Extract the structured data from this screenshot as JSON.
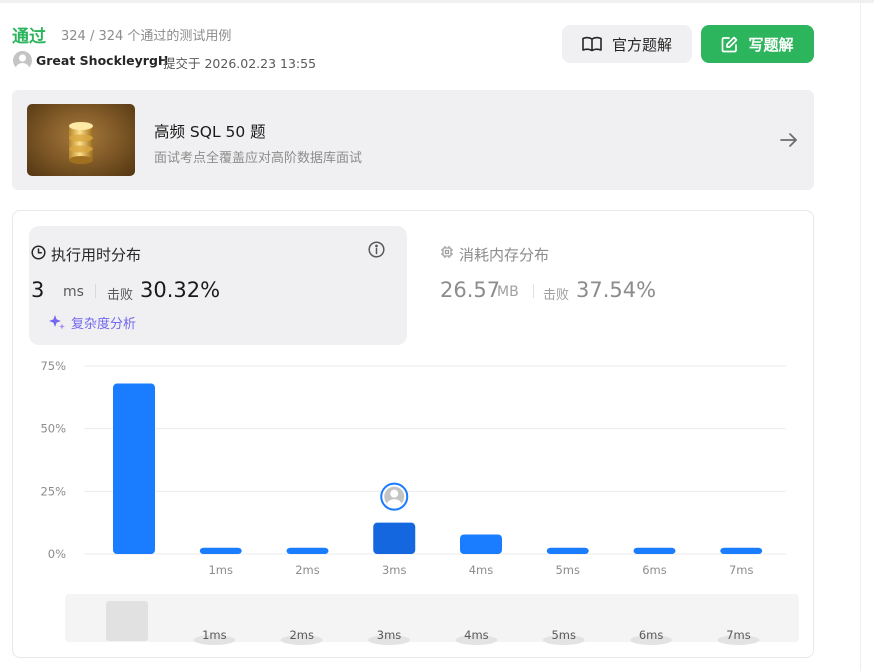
{
  "result": {
    "status": "通过",
    "tests_passed": "324 / 324 个通过的测试用例",
    "user": "Great ShockleyrgH",
    "submitted_at": "提交于 2026.02.23 13:55"
  },
  "actions": {
    "official_solution": "官方题解",
    "write_solution": "写题解"
  },
  "banner": {
    "title": "高频 SQL 50 题",
    "subtitle": "面试考点全覆盖应对高阶数据库面试"
  },
  "runtime": {
    "title": "执行用时分布",
    "value": "3",
    "unit": "ms",
    "beats_label": "击败",
    "beats_pct": "30.32%",
    "complexity_link": "复杂度分析"
  },
  "memory": {
    "title": "消耗内存分布",
    "value": "26.57",
    "unit": "MB",
    "beats_label": "击败",
    "beats_pct": "37.54%"
  },
  "colors": {
    "accept_green": "#2db55d",
    "bar_blue": "#1a7cff",
    "bar_selected": "#1567e0",
    "complexity_purple": "#7367f0"
  },
  "icons": {
    "official": "book-open-icon",
    "write": "edit-icon",
    "runtime": "clock-icon",
    "info": "info-icon",
    "complexity": "sparkle-icon",
    "memory": "chip-icon",
    "banner_arrow": "arrow-right-icon",
    "banner_image": "database-icon"
  },
  "chart_data": {
    "type": "bar",
    "title": "",
    "xlabel": "",
    "ylabel": "",
    "categories": [
      "",
      "1ms",
      "2ms",
      "3ms",
      "4ms",
      "5ms",
      "6ms",
      "7ms"
    ],
    "values": [
      68,
      2.5,
      2.5,
      12.5,
      7.8,
      2.5,
      2.5,
      2.5
    ],
    "yticks": [
      "0%",
      "25%",
      "50%",
      "75%"
    ],
    "ylim": [
      0,
      75
    ],
    "grid": true,
    "selected_category": "3ms",
    "overview_categories": [
      "",
      "1ms",
      "2ms",
      "3ms",
      "4ms",
      "5ms",
      "6ms",
      "7ms"
    ]
  }
}
